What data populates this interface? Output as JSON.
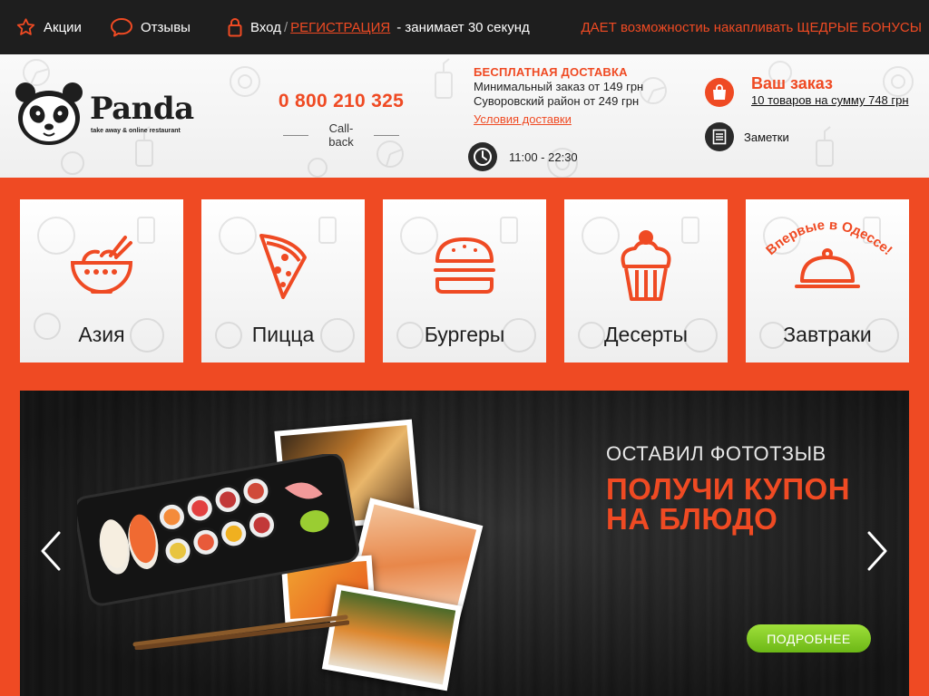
{
  "topbar": {
    "promotions_label": "Акции",
    "reviews_label": "Отзывы",
    "login_label": "Вход",
    "separator": "/",
    "register_label": "РЕГИСТРАЦИЯ",
    "register_note": "- занимает 30 секунд",
    "promo_text": "ДАЕТ возможностиь накапливать ЩЕДРЫЕ БОНУСЫ"
  },
  "header": {
    "brand": "Panda",
    "tagline": "take away & online restaurant",
    "phone": "0 800 210 325",
    "callback_label": "Call-back",
    "delivery": {
      "title": "БЕСПЛАТНАЯ ДОСТАВКА",
      "line1": "Минимальный заказ от 149 грн",
      "line2": "Суворовский район от 249 грн",
      "conditions_link": "Условия доставки"
    },
    "hours": "11:00 - 22:30",
    "cart": {
      "title": "Ваш заказ",
      "summary": "10 товаров на сумму 748 грн"
    },
    "notes_label": "Заметки"
  },
  "categories": [
    {
      "label": "Азия",
      "icon": "noodle-bowl-icon"
    },
    {
      "label": "Пицца",
      "icon": "pizza-slice-icon"
    },
    {
      "label": "Бургеры",
      "icon": "burger-icon"
    },
    {
      "label": "Десерты",
      "icon": "cupcake-icon"
    },
    {
      "label": "Завтраки",
      "icon": "cloche-icon",
      "badge": "Впервые в Одессе!"
    }
  ],
  "banner": {
    "line1": "ОСТАВИЛ ФОТОТЗЫВ",
    "line2": "ПОЛУЧИ КУПОН НА БЛЮДО",
    "button_label": "ПОДРОБНЕЕ"
  },
  "colors": {
    "accent": "#ef4a23",
    "dark": "#1e1e1e",
    "button_green": "#7cc522"
  }
}
